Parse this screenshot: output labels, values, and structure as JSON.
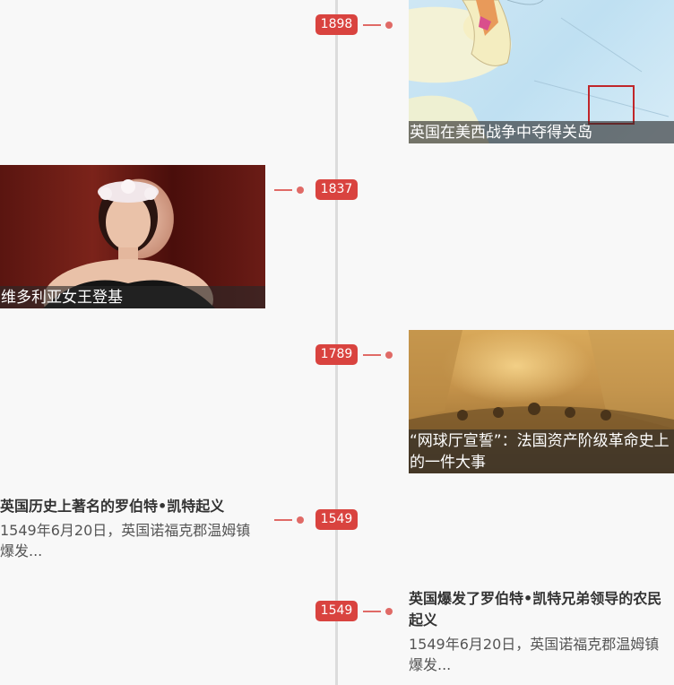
{
  "events": [
    {
      "year": "1898",
      "caption": "英国在美西战争中夺得关岛",
      "image": "historical-map"
    },
    {
      "year": "1837",
      "caption": "维多利亚女王登基",
      "image": "queen-victoria-portrait"
    },
    {
      "year": "1789",
      "caption": "“网球厅宣誓”：法国资产阶级革命史上的一件大事",
      "image": "tennis-court-oath-painting"
    },
    {
      "year": "1549",
      "title": "英国历史上著名的罗伯特•凯特起义",
      "summary": "1549年6月20日，英国诺福克郡温姆镇爆发..."
    },
    {
      "year": "1549",
      "title": "英国爆发了罗伯特•凯特兄弟领导的农民起义",
      "summary": "1549年6月20日，英国诺福克郡温姆镇爆发..."
    }
  ],
  "colors": {
    "accent": "#d9433f",
    "connector": "#e06a66",
    "spine": "#dcdcdc"
  }
}
